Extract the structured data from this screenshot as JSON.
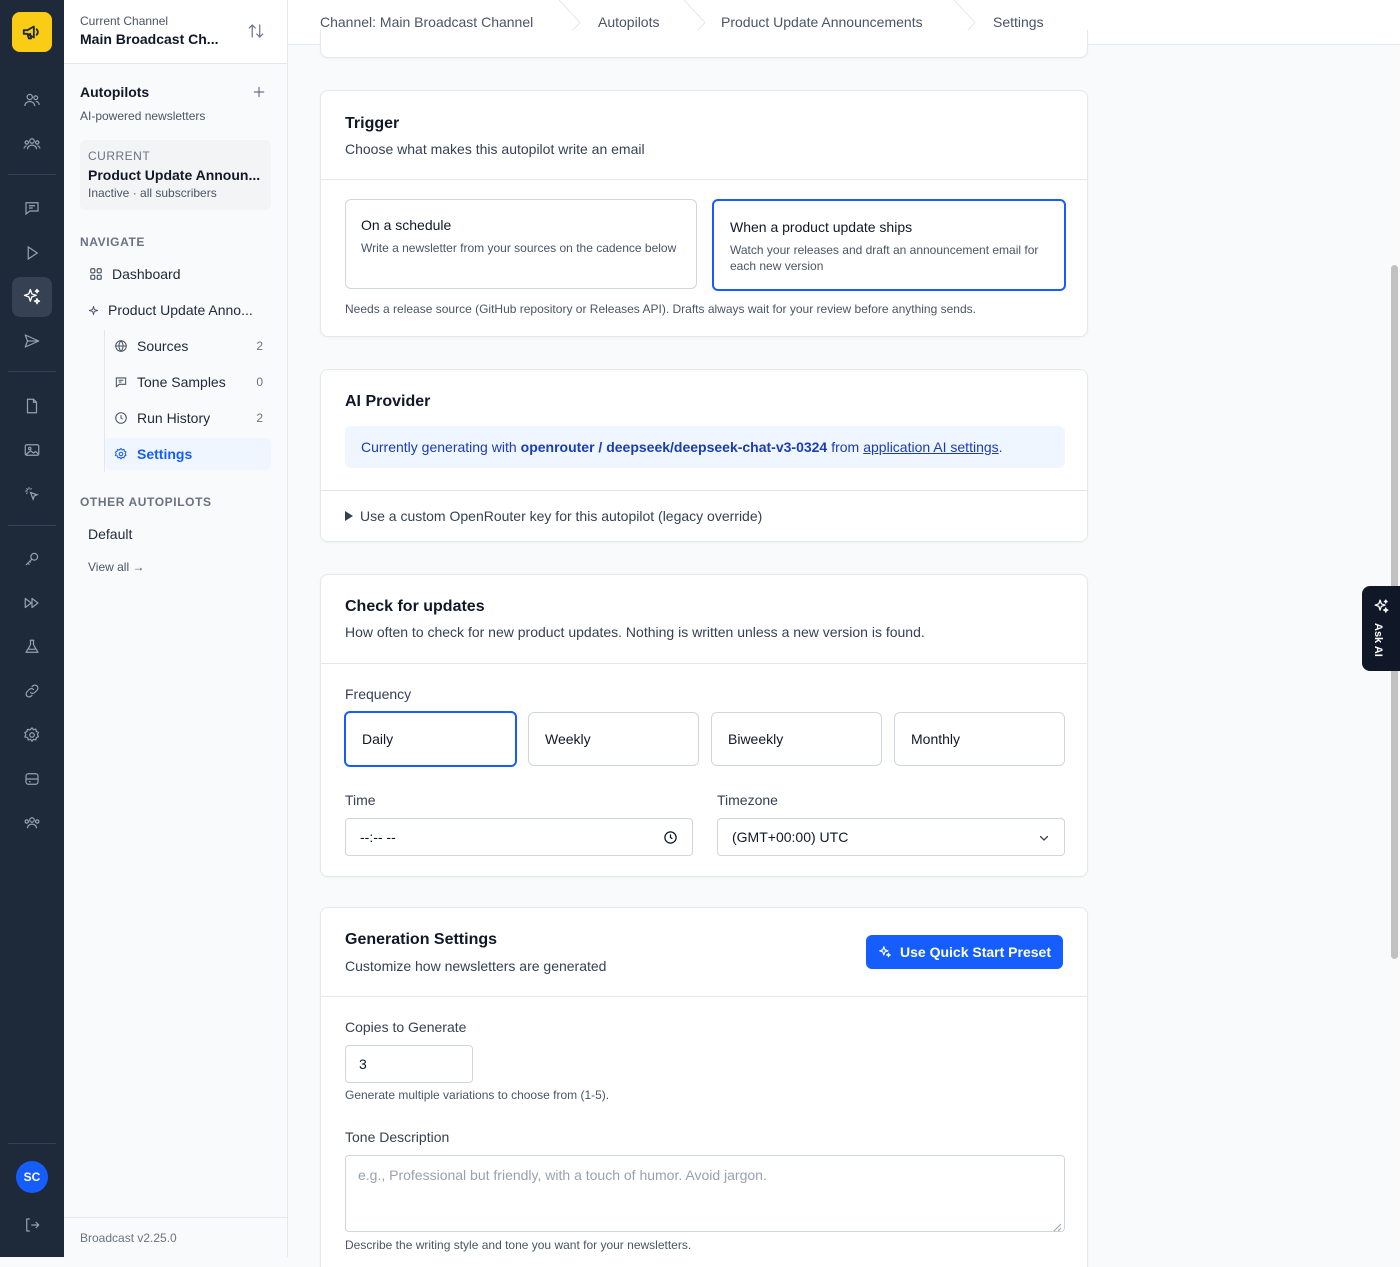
{
  "rail": {
    "logo_icon": "megaphone-icon",
    "avatar": "SC",
    "colors": {
      "background": "#1e2939",
      "logo": "#facc15",
      "avatar": "#155dfc"
    }
  },
  "sidebar": {
    "current_channel_label": "Current Channel",
    "current_channel_name": "Main Broadcast Ch...",
    "section_title": "Autopilots",
    "section_subtitle": "AI-powered newsletters",
    "current": {
      "label": "CURRENT",
      "name": "Product Update Announ...",
      "status": "Inactive · all subscribers"
    },
    "navigate_label": "NAVIGATE",
    "nav": [
      {
        "label": "Dashboard",
        "icon": "grid-icon"
      },
      {
        "label": "Product Update Anno...",
        "icon": "sparkle-icon"
      },
      {
        "label": "Sources",
        "icon": "globe-icon",
        "count": "2"
      },
      {
        "label": "Tone Samples",
        "icon": "chat-icon",
        "count": "0"
      },
      {
        "label": "Run History",
        "icon": "clock-icon",
        "count": "2"
      },
      {
        "label": "Settings",
        "icon": "gear-icon"
      }
    ],
    "other_label": "OTHER AUTOPILOTS",
    "other_items": [
      {
        "label": "Default"
      }
    ],
    "view_all": "View all →",
    "version": "Broadcast v2.25.0"
  },
  "breadcrumbs": [
    "Channel: Main Broadcast Channel",
    "Autopilots",
    "Product Update Announcements",
    "Settings"
  ],
  "trigger": {
    "title": "Trigger",
    "description": "Choose what makes this autopilot write an email",
    "options": [
      {
        "title": "On a schedule",
        "description": "Write a newsletter from your sources on the cadence below",
        "selected": false
      },
      {
        "title": "When a product update ships",
        "description": "Watch your releases and draft an announcement email for each new version",
        "selected": true
      }
    ],
    "note": "Needs a release source (GitHub repository or Releases API). Drafts always wait for your review before anything sends."
  },
  "ai_provider": {
    "title": "AI Provider",
    "info_prefix": "Currently generating with",
    "model": "openrouter / deepseek/deepseek-chat-v3-0324",
    "info_middle": "from",
    "link": "application AI settings",
    "info_suffix": ".",
    "custom_key": "Use a custom OpenRouter key for this autopilot (legacy override)"
  },
  "check_updates": {
    "title": "Check for updates",
    "description": "How often to check for new product updates. Nothing is written unless a new version is found.",
    "frequency_label": "Frequency",
    "frequencies": [
      "Daily",
      "Weekly",
      "Biweekly",
      "Monthly"
    ],
    "selected_frequency": "Daily",
    "time_label": "Time",
    "time_value": "--:-- --",
    "timezone_label": "Timezone",
    "timezone_value": "(GMT+00:00) UTC"
  },
  "generation": {
    "title": "Generation Settings",
    "description": "Customize how newsletters are generated",
    "preset_button": "Use Quick Start Preset",
    "copies_label": "Copies to Generate",
    "copies_value": "3",
    "copies_help": "Generate multiple variations to choose from (1-5).",
    "tone_label": "Tone Description",
    "tone_placeholder": "e.g., Professional but friendly, with a touch of humor. Avoid jargon.",
    "tone_help": "Describe the writing style and tone you want for your newsletters."
  },
  "ask_ai": {
    "label": "Ask AI"
  },
  "colors": {
    "accent": "#155dfc",
    "info_bg": "#eff6ff",
    "info_text": "#193cb8"
  }
}
